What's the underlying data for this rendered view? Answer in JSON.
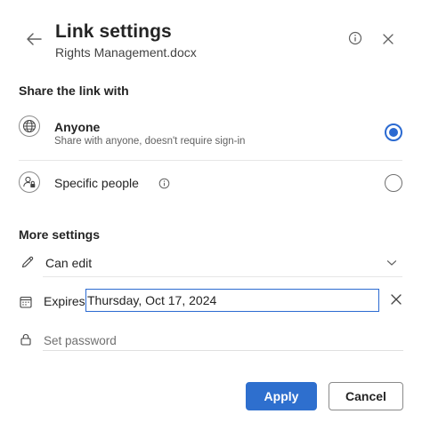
{
  "header": {
    "title": "Link settings",
    "file_name": "Rights Management.docx"
  },
  "share": {
    "heading": "Share the link with",
    "options": [
      {
        "title": "Anyone",
        "description": "Share with anyone, doesn't require sign-in",
        "selected": true,
        "icon": "globe-icon"
      },
      {
        "title": "Specific people",
        "selected": false,
        "icon": "people-lock-icon"
      }
    ]
  },
  "more": {
    "heading": "More settings",
    "permission": "Can edit",
    "expires_label": "Expires",
    "expires_value": "Thursday, Oct 17, 2024",
    "password_placeholder": "Set password"
  },
  "actions": {
    "apply": "Apply",
    "cancel": "Cancel"
  },
  "colors": {
    "accent": "#2b6ad1",
    "apply_bg": "#2e6fce"
  }
}
